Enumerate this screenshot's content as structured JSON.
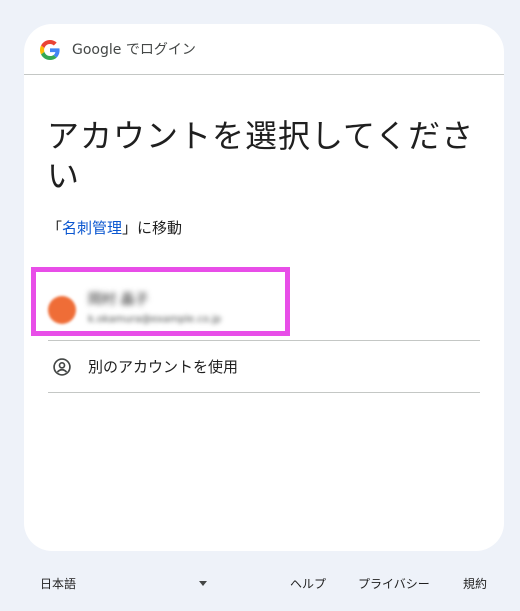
{
  "header": {
    "title": "Google でログイン"
  },
  "main": {
    "title": "アカウントを選択してください",
    "subtitle_prefix": "「",
    "app_name": "名刺管理",
    "subtitle_suffix": "」に移動"
  },
  "account": {
    "name": "岡村 晶子",
    "email": "k.okamura@example.co.jp",
    "avatar_color": "#ef6d37"
  },
  "other_account": {
    "label": "別のアカウントを使用",
    "icon": "account-circle-icon"
  },
  "footer": {
    "language": "日本語",
    "help": "ヘルプ",
    "privacy": "プライバシー",
    "terms": "規約"
  },
  "colors": {
    "background": "#eef2f9",
    "card": "#ffffff",
    "link": "#0b57d0",
    "highlight": "#e84ee8"
  }
}
